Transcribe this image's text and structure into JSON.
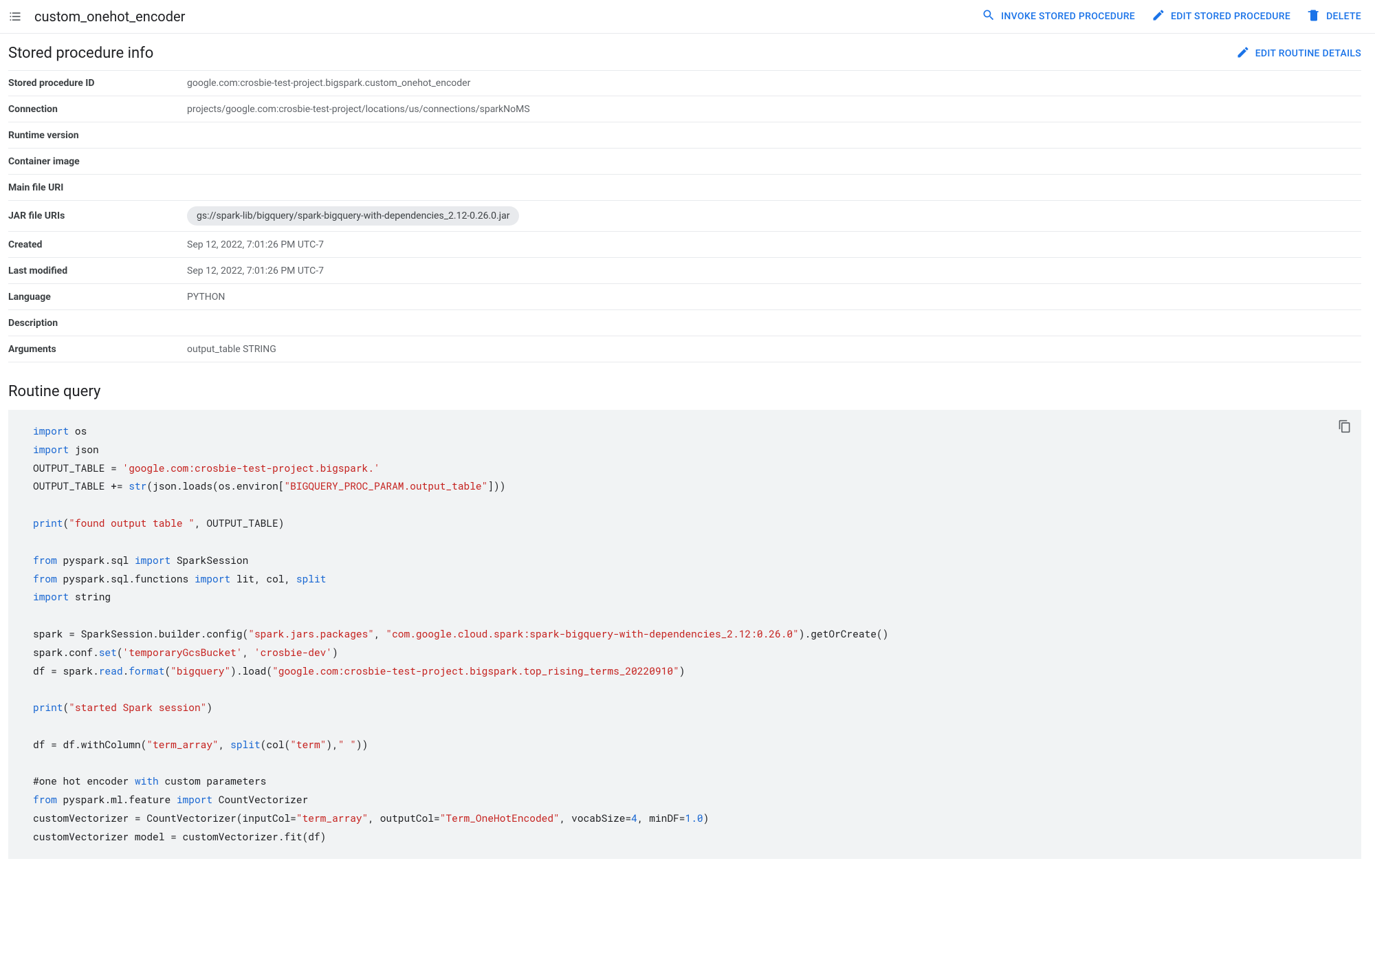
{
  "header": {
    "title": "custom_onehot_encoder",
    "actions": {
      "invoke": "INVOKE STORED PROCEDURE",
      "edit": "EDIT STORED PROCEDURE",
      "delete": "DELETE"
    }
  },
  "info_section": {
    "title": "Stored procedure info",
    "edit_details": "EDIT ROUTINE DETAILS"
  },
  "info": {
    "stored_procedure_id": {
      "label": "Stored procedure ID",
      "value": "google.com:crosbie-test-project.bigspark.custom_onehot_encoder"
    },
    "connection": {
      "label": "Connection",
      "value": "projects/google.com:crosbie-test-project/locations/us/connections/sparkNoMS"
    },
    "runtime_version": {
      "label": "Runtime version",
      "value": ""
    },
    "container_image": {
      "label": "Container image",
      "value": ""
    },
    "main_file_uri": {
      "label": "Main file URI",
      "value": ""
    },
    "jar_file_uris": {
      "label": "JAR file URIs",
      "value": "gs://spark-lib/bigquery/spark-bigquery-with-dependencies_2.12-0.26.0.jar"
    },
    "created": {
      "label": "Created",
      "value": "Sep 12, 2022, 7:01:26 PM UTC-7"
    },
    "last_modified": {
      "label": "Last modified",
      "value": "Sep 12, 2022, 7:01:26 PM UTC-7"
    },
    "language": {
      "label": "Language",
      "value": "PYTHON"
    },
    "description": {
      "label": "Description",
      "value": ""
    },
    "arguments": {
      "label": "Arguments",
      "value": "output_table STRING"
    }
  },
  "routine_query_title": "Routine query",
  "code": {
    "l1a": "import",
    "l1b": " os",
    "l2a": "import",
    "l2b": " json",
    "l3a": "OUTPUT_TABLE = ",
    "l3b": "'google.com:crosbie-test-project.bigspark.'",
    "l4a": "OUTPUT_TABLE += ",
    "l4b": "str",
    "l4c": "(json.loads(os.environ[",
    "l4d": "\"BIGQUERY_PROC_PARAM.output_table\"",
    "l4e": "]))",
    "l5a": "print",
    "l5b": "(",
    "l5c": "\"found output table \"",
    "l5d": ", OUTPUT_TABLE)",
    "l6a": "from",
    "l6b": " pyspark.sql ",
    "l6c": "import",
    "l6d": " SparkSession",
    "l7a": "from",
    "l7b": " pyspark.sql.functions ",
    "l7c": "import",
    "l7d": " lit, col, ",
    "l7e": "split",
    "l8a": "import",
    "l8b": " string",
    "l9a": "spark = SparkSession.builder.config(",
    "l9b": "\"spark.jars.packages\"",
    "l9c": ", ",
    "l9d": "\"com.google.cloud.spark:spark-bigquery-with-dependencies_2.12:0.26.0\"",
    "l9e": ").getOrCreate()",
    "l10a": "spark.conf.",
    "l10b": "set",
    "l10c": "(",
    "l10d": "'temporaryGcsBucket'",
    "l10e": ", ",
    "l10f": "'crosbie-dev'",
    "l10g": ")",
    "l11a": "df = spark.",
    "l11b": "read",
    "l11c": ".",
    "l11d": "format",
    "l11e": "(",
    "l11f": "\"bigquery\"",
    "l11g": ").load(",
    "l11h": "\"google.com:crosbie-test-project.bigspark.top_rising_terms_20220910\"",
    "l11i": ")",
    "l12a": "print",
    "l12b": "(",
    "l12c": "\"started Spark session\"",
    "l12d": ")",
    "l13a": "df = df.withColumn(",
    "l13b": "\"term_array\"",
    "l13c": ", ",
    "l13d": "split",
    "l13e": "(col(",
    "l13f": "\"term\"",
    "l13g": "),",
    "l13h": "\" \"",
    "l13i": "))",
    "l14a": "#one hot encoder ",
    "l14b": "with",
    "l14c": " custom parameters",
    "l15a": "from",
    "l15b": " pyspark.ml.feature ",
    "l15c": "import",
    "l15d": " CountVectorizer",
    "l16a": "customVectorizer = CountVectorizer(inputCol=",
    "l16b": "\"term_array\"",
    "l16c": ", outputCol=",
    "l16d": "\"Term_OneHotEncoded\"",
    "l16e": ", vocabSize=",
    "l16f": "4",
    "l16g": ", minDF=",
    "l16h": "1.0",
    "l16i": ")",
    "l17a": "customVectorizer model = customVectorizer.fit(df)"
  }
}
